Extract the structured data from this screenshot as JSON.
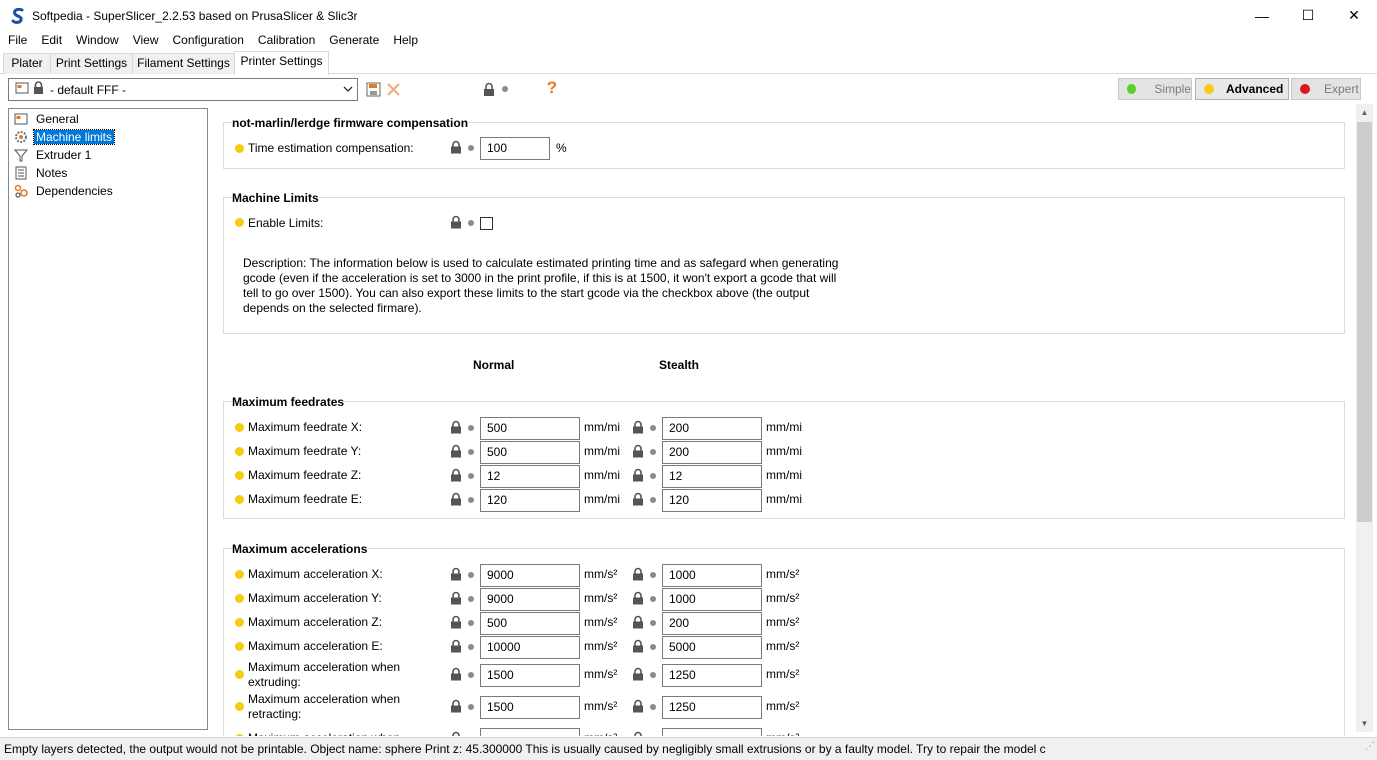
{
  "window": {
    "title": "Softpedia - SuperSlicer_2.2.53 based on PrusaSlicer & Slic3r",
    "controls": [
      "—",
      "☐",
      "✕"
    ]
  },
  "menu": [
    "File",
    "Edit",
    "Window",
    "View",
    "Configuration",
    "Calibration",
    "Generate",
    "Help"
  ],
  "tabs": [
    "Plater",
    "Print Settings",
    "Filament Settings",
    "Printer Settings"
  ],
  "preset": {
    "value": "- default FFF -"
  },
  "toolbar": {
    "help_glyph": "?"
  },
  "modes": [
    {
      "label": "Simple",
      "color": "#5ad12a"
    },
    {
      "label": "Advanced",
      "color": "#f6cc12"
    },
    {
      "label": "Expert",
      "color": "#e0151a"
    }
  ],
  "tree": [
    "General",
    "Machine limits",
    "Extruder 1",
    "Notes",
    "Dependencies"
  ],
  "compensation": {
    "title": "not-marlin/lerdge firmware compensation",
    "label": "Time estimation compensation:",
    "value": "100",
    "unit": "%"
  },
  "machine_limits": {
    "title": "Machine Limits",
    "enable_label": "Enable Limits:",
    "description": "Description: The information below is used to calculate estimated printing time and as safegard when generating gcode (even if the acceleration is set to 3000 in the print profile, if this is at 1500, it won't export a gcode that will tell to go over 1500). You can also export these limits to the start gcode via the checkbox above (the output depends on the selected firmare)."
  },
  "columns": {
    "normal": "Normal",
    "stealth": "Stealth"
  },
  "feedrates": {
    "title": "Maximum feedrates",
    "unit": "mm/mi",
    "rows": [
      {
        "label": "Maximum feedrate X:",
        "normal": "500",
        "stealth": "200"
      },
      {
        "label": "Maximum feedrate Y:",
        "normal": "500",
        "stealth": "200"
      },
      {
        "label": "Maximum feedrate Z:",
        "normal": "12",
        "stealth": "12"
      },
      {
        "label": "Maximum feedrate E:",
        "normal": "120",
        "stealth": "120"
      }
    ]
  },
  "accelerations": {
    "title": "Maximum accelerations",
    "unit": "mm/s²",
    "rows": [
      {
        "label": "Maximum acceleration X:",
        "normal": "9000",
        "stealth": "1000"
      },
      {
        "label": "Maximum acceleration Y:",
        "normal": "9000",
        "stealth": "1000"
      },
      {
        "label": "Maximum acceleration Z:",
        "normal": "500",
        "stealth": "200"
      },
      {
        "label": "Maximum acceleration E:",
        "normal": "10000",
        "stealth": "5000"
      },
      {
        "label": "Maximum acceleration when extruding:",
        "normal": "1500",
        "stealth": "1250"
      },
      {
        "label": "Maximum acceleration when retracting:",
        "normal": "1500",
        "stealth": "1250"
      },
      {
        "label": "Maximum acceleration when",
        "normal": "",
        "stealth": ""
      }
    ]
  },
  "status": "Empty layers detected, the output would not be printable.  Object name: sphere Print z: 45.300000  This is usually caused by negligibly small extrusions or by a faulty model. Try to repair the model c",
  "colors": {
    "accent": "#0078d7",
    "mode_dot": "#f6cc12",
    "help": "#e8781e"
  }
}
